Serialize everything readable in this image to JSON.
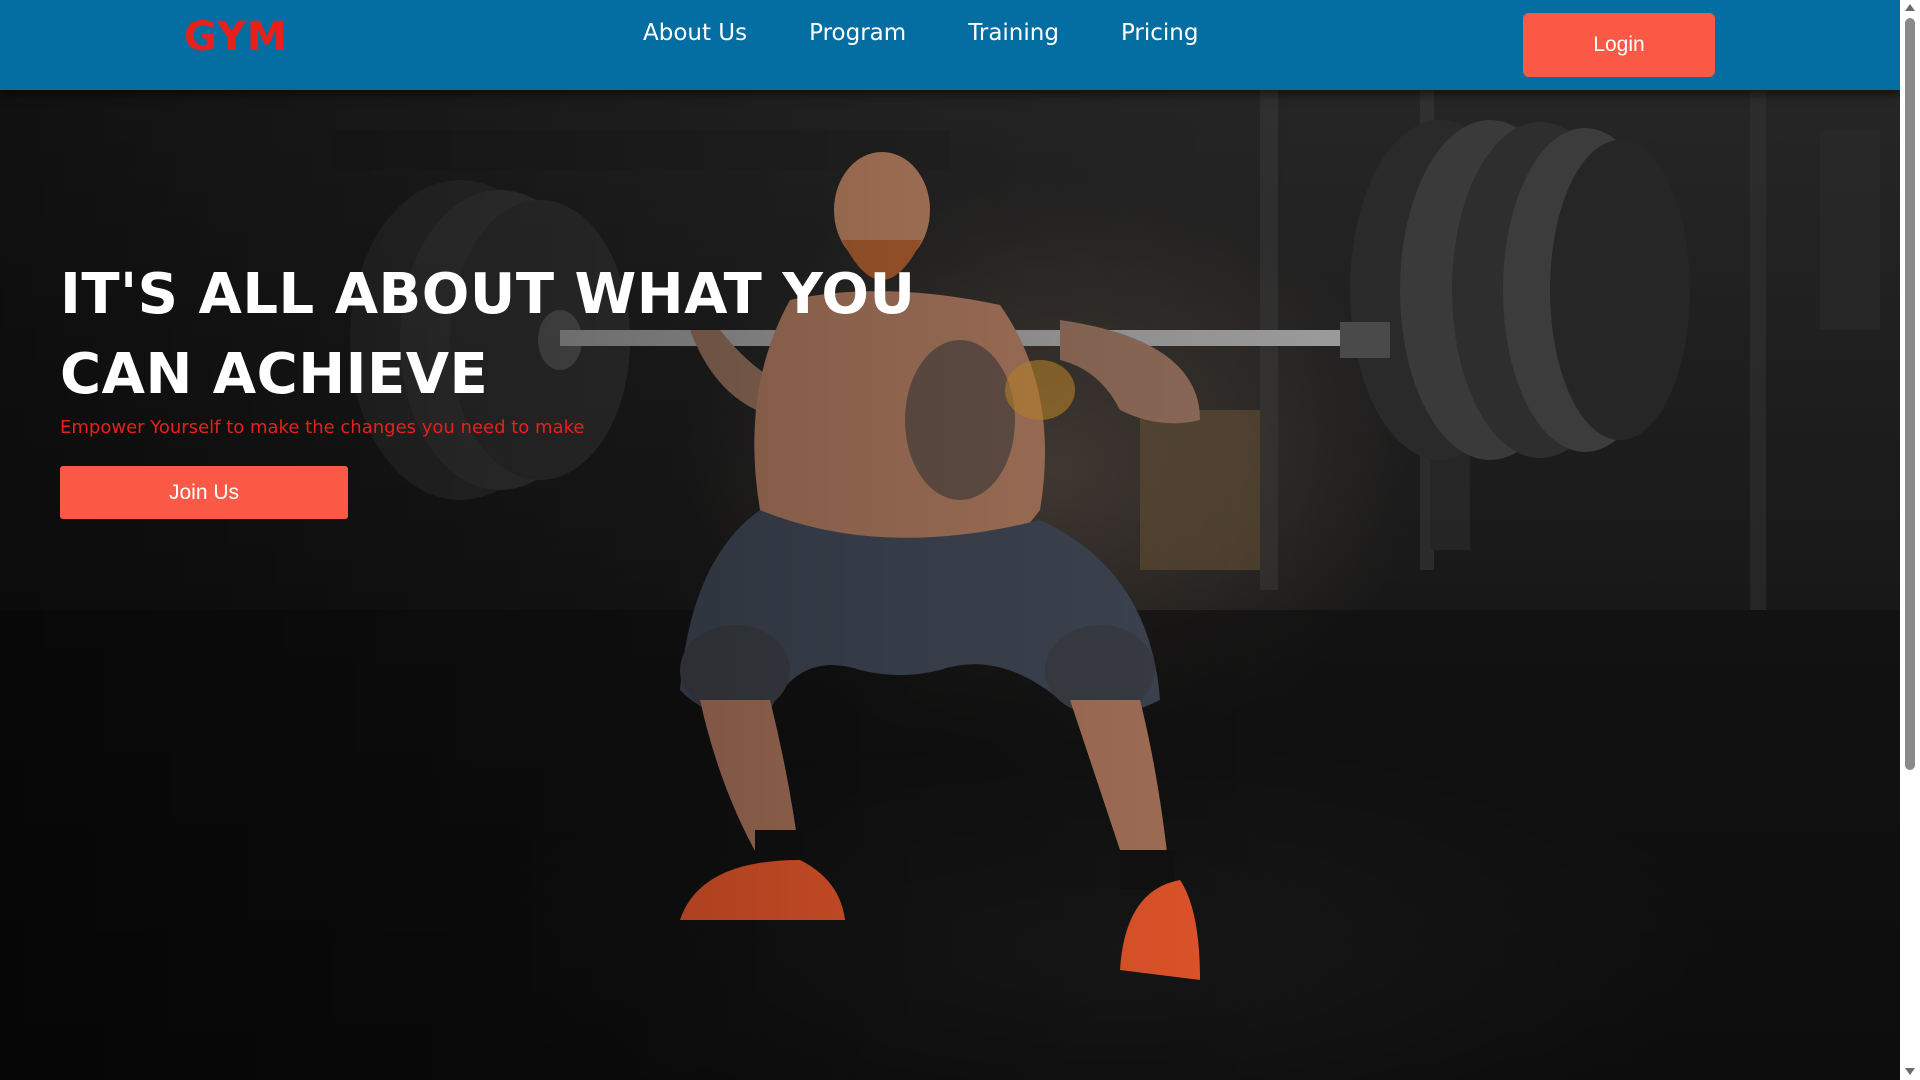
{
  "navbar": {
    "logo": "GYM",
    "links": [
      "About Us",
      "Program",
      "Training",
      "Pricing"
    ],
    "login_label": "Login"
  },
  "hero": {
    "title_line1": "IT'S ALL ABOUT WHAT YOU",
    "title_line2": "CAN ACHIEVE",
    "subtitle": "Empower Yourself to make the changes you need to make",
    "join_label": "Join Us"
  },
  "colors": {
    "navbar_bg": "#046ea3",
    "accent_button": "#fa5a45",
    "logo_red": "#e8201c",
    "subtitle_red": "#e8201c"
  }
}
